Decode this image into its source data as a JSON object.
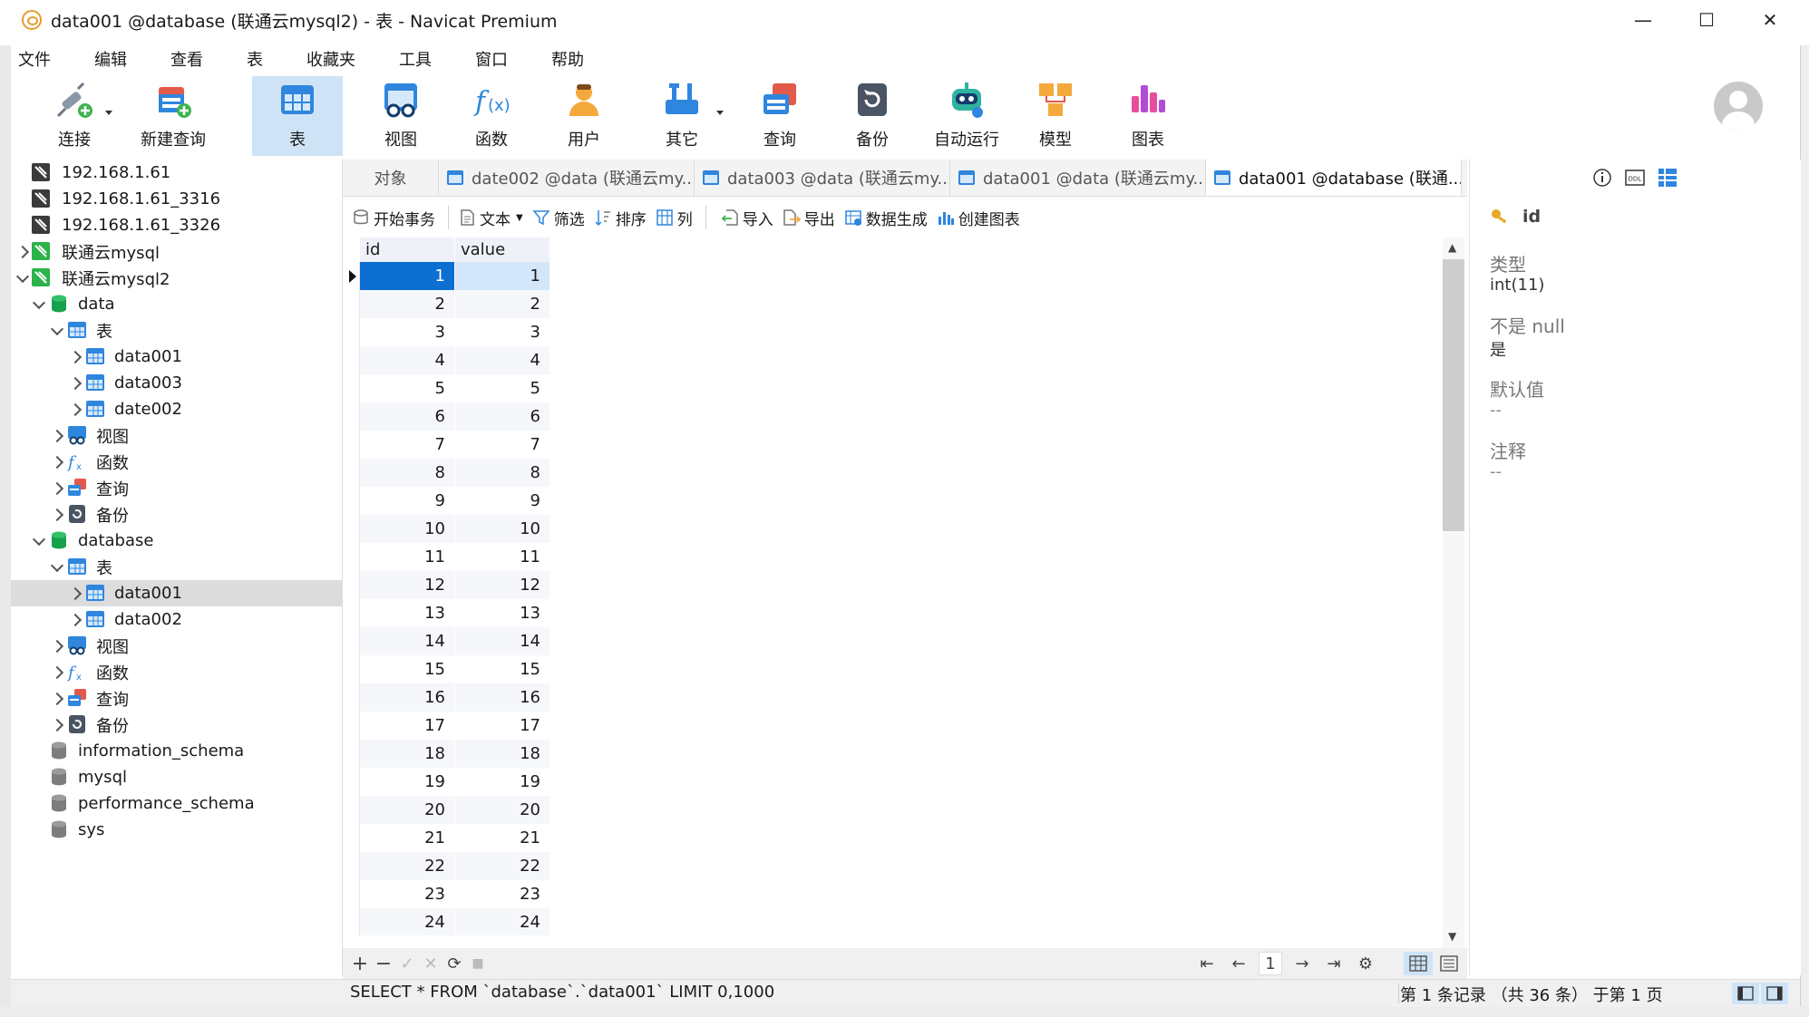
{
  "window": {
    "title": "data001 @database (联通云mysql2) - 表 - Navicat Premium",
    "minimize": "—",
    "maximize": "☐",
    "close": "✕"
  },
  "menu": [
    "文件",
    "编辑",
    "查看",
    "表",
    "收藏夹",
    "工具",
    "窗口",
    "帮助"
  ],
  "toolbar": [
    {
      "label": "连接",
      "icon": "plug-add-icon"
    },
    {
      "label": "新建查询",
      "icon": "new-query-icon"
    },
    {
      "label": "表",
      "icon": "table-icon"
    },
    {
      "label": "视图",
      "icon": "view-icon"
    },
    {
      "label": "函数",
      "icon": "function-icon"
    },
    {
      "label": "用户",
      "icon": "user-icon"
    },
    {
      "label": "其它",
      "icon": "tools-icon"
    },
    {
      "label": "查询",
      "icon": "query-icon"
    },
    {
      "label": "备份",
      "icon": "backup-icon"
    },
    {
      "label": "自动运行",
      "icon": "robot-icon"
    },
    {
      "label": "模型",
      "icon": "model-icon"
    },
    {
      "label": "图表",
      "icon": "chart-icon"
    }
  ],
  "tree": [
    {
      "label": "192.168.1.61",
      "icon": "connection-icon"
    },
    {
      "label": "192.168.1.61_3316",
      "icon": "connection-icon"
    },
    {
      "label": "192.168.1.61_3326",
      "icon": "connection-icon"
    },
    {
      "label": "联通云mysql",
      "icon": "connection-open-icon"
    },
    {
      "label": "联通云mysql2",
      "icon": "connection-open-icon"
    },
    {
      "label": "data",
      "icon": "database-icon"
    },
    {
      "label": "表",
      "icon": "table-icon"
    },
    {
      "label": "data001",
      "icon": "table-icon"
    },
    {
      "label": "data003",
      "icon": "table-icon"
    },
    {
      "label": "date002",
      "icon": "table-icon"
    },
    {
      "label": "视图",
      "icon": "view-icon"
    },
    {
      "label": "函数",
      "icon": "function-icon"
    },
    {
      "label": "查询",
      "icon": "query-icon"
    },
    {
      "label": "备份",
      "icon": "backup-icon"
    },
    {
      "label": "database",
      "icon": "database-icon"
    },
    {
      "label": "表",
      "icon": "table-icon"
    },
    {
      "label": "data001",
      "icon": "table-icon"
    },
    {
      "label": "data002",
      "icon": "table-icon"
    },
    {
      "label": "视图",
      "icon": "view-icon"
    },
    {
      "label": "函数",
      "icon": "function-icon"
    },
    {
      "label": "查询",
      "icon": "query-icon"
    },
    {
      "label": "备份",
      "icon": "backup-icon"
    },
    {
      "label": "information_schema",
      "icon": "database-gray-icon"
    },
    {
      "label": "mysql",
      "icon": "database-gray-icon"
    },
    {
      "label": "performance_schema",
      "icon": "database-gray-icon"
    },
    {
      "label": "sys",
      "icon": "database-gray-icon"
    }
  ],
  "tabs": [
    {
      "label": "对象"
    },
    {
      "label": "date002 @data (联通云my..."
    },
    {
      "label": "data003 @data (联通云my..."
    },
    {
      "label": "data001 @data (联通云my..."
    },
    {
      "label": "data001 @database (联通..."
    }
  ],
  "objectbar": {
    "begin_tx": "开始事务",
    "text": "文本",
    "filter": "筛选",
    "sort": "排序",
    "columns": "列",
    "import": "导入",
    "export": "导出",
    "datagen": "数据生成",
    "create_chart": "创建图表"
  },
  "grid": {
    "columns": [
      "id",
      "value"
    ],
    "rows": [
      [
        "1",
        "1"
      ],
      [
        "2",
        "2"
      ],
      [
        "3",
        "3"
      ],
      [
        "4",
        "4"
      ],
      [
        "5",
        "5"
      ],
      [
        "6",
        "6"
      ],
      [
        "7",
        "7"
      ],
      [
        "8",
        "8"
      ],
      [
        "9",
        "9"
      ],
      [
        "10",
        "10"
      ],
      [
        "11",
        "11"
      ],
      [
        "12",
        "12"
      ],
      [
        "13",
        "13"
      ],
      [
        "14",
        "14"
      ],
      [
        "15",
        "15"
      ],
      [
        "16",
        "16"
      ],
      [
        "17",
        "17"
      ],
      [
        "18",
        "18"
      ],
      [
        "19",
        "19"
      ],
      [
        "20",
        "20"
      ],
      [
        "21",
        "21"
      ],
      [
        "22",
        "22"
      ],
      [
        "23",
        "23"
      ],
      [
        "24",
        "24"
      ]
    ]
  },
  "bottombar": {
    "add": "+",
    "remove": "−",
    "apply": "✓",
    "discard": "✕",
    "refresh": "⟳",
    "stop": "■",
    "first": "⇤",
    "prev": "←",
    "page": "1",
    "next": "→",
    "last": "⇥",
    "settings": "⚙"
  },
  "status": {
    "sql": "SELECT * FROM `database`.`data001` LIMIT 0,1000",
    "records": "第 1 条记录 （共 36 条） 于第 1 页"
  },
  "rightpanel": {
    "field_name": "id",
    "type_label": "类型",
    "type_value": "int(11)",
    "notnull_label": "不是 null",
    "notnull_value": "是",
    "default_label": "默认值",
    "default_value": "--",
    "comment_label": "注释",
    "comment_value": "--"
  },
  "colors": {
    "accent": "#0c6fd1",
    "active_tool": "#cfe3f7",
    "selected_tree": "#dcdcdc"
  }
}
